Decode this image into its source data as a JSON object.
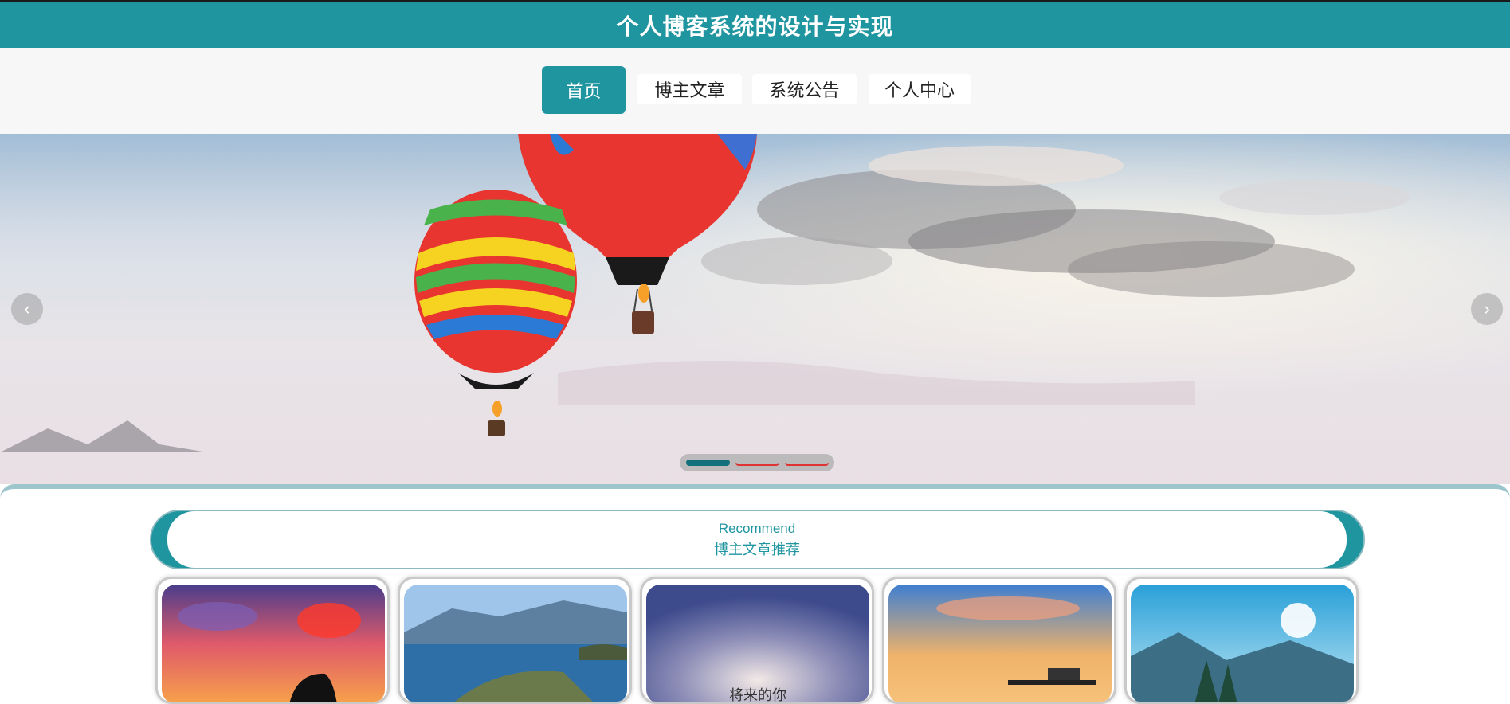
{
  "header": {
    "title": "个人博客系统的设计与实现"
  },
  "nav": {
    "items": [
      {
        "label": "首页",
        "active": true
      },
      {
        "label": "博主文章",
        "active": false
      },
      {
        "label": "系统公告",
        "active": false
      },
      {
        "label": "个人中心",
        "active": false
      }
    ]
  },
  "banner": {
    "prev_icon": "chevron-left-icon",
    "next_icon": "chevron-right-icon",
    "slides": 3,
    "active_slide": 1
  },
  "recommend": {
    "title_en": "Recommend",
    "title_cn": "博主文章推荐"
  },
  "articles": [
    {
      "image": "dolphin-sunset"
    },
    {
      "image": "lake-island"
    },
    {
      "image": "future-you-sky",
      "caption": "将来的你"
    },
    {
      "image": "pier-sunset"
    },
    {
      "image": "mountain-forest"
    }
  ],
  "colors": {
    "primary": "#1f95a0",
    "nav_bg": "#f7f7f7",
    "text_dark": "#222222"
  }
}
